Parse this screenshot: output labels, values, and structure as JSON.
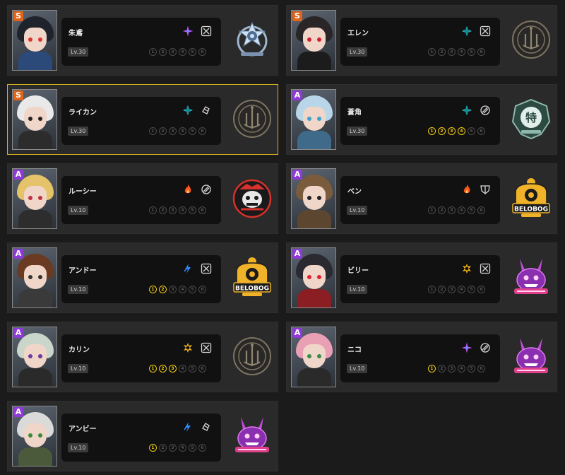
{
  "cinema_numbers": [
    "1",
    "2",
    "3",
    "4",
    "5",
    "6"
  ],
  "colors": {
    "attr_ice": "#1fc9d8",
    "attr_fire": "#ff5a1e",
    "attr_electric": "#2f8cff",
    "attr_physical": "#f3b41a",
    "attr_ether": "#d44bff",
    "cinema_on": "#f4cc12",
    "selected_border": "#d7b11f"
  },
  "agents": [
    {
      "name": "朱鳶",
      "level": "Lv.30",
      "rank": "S",
      "attribute": "ether",
      "specialty": "attack",
      "cinema": 0,
      "faction": "public-security",
      "selected": false,
      "hair": "#1f232c",
      "eye": "#d33",
      "body": "#2b4a7a"
    },
    {
      "name": "エレン",
      "level": "Lv.30",
      "rank": "S",
      "attribute": "ice",
      "specialty": "attack",
      "cinema": 0,
      "faction": "victoria-housekeeping",
      "selected": false,
      "hair": "#2a2628",
      "eye": "#d02030",
      "body": "#1c1c1c"
    },
    {
      "name": "ライカン",
      "level": "Lv.30",
      "rank": "S",
      "attribute": "ice",
      "specialty": "stun",
      "cinema": 0,
      "faction": "victoria-housekeeping",
      "selected": true,
      "hair": "#e9e9e9",
      "eye": "#222",
      "body": "#2c2c2c"
    },
    {
      "name": "蒼角",
      "level": "Lv.30",
      "rank": "A",
      "attribute": "ice",
      "specialty": "support",
      "cinema": 4,
      "faction": "section-6",
      "selected": false,
      "hair": "#b8d6e8",
      "eye": "#3aa0d0",
      "body": "#3f6a8a"
    },
    {
      "name": "ルーシー",
      "level": "Lv.10",
      "rank": "A",
      "attribute": "fire",
      "specialty": "support",
      "cinema": 0,
      "faction": "sons-of-calydon",
      "selected": false,
      "hair": "#e4c36a",
      "eye": "#c03040",
      "body": "#2d2d2d"
    },
    {
      "name": "ベン",
      "level": "Lv.10",
      "rank": "A",
      "attribute": "fire",
      "specialty": "defense",
      "cinema": 0,
      "faction": "belobog",
      "selected": false,
      "hair": "#7a5b3c",
      "eye": "#222",
      "body": "#5c4630"
    },
    {
      "name": "アンドー",
      "level": "Lv.10",
      "rank": "A",
      "attribute": "electric",
      "specialty": "attack",
      "cinema": 2,
      "faction": "belobog",
      "selected": false,
      "hair": "#6a3a22",
      "eye": "#333",
      "body": "#3a3a3a"
    },
    {
      "name": "ビリー",
      "level": "Lv.10",
      "rank": "A",
      "attribute": "physical",
      "specialty": "attack",
      "cinema": 0,
      "faction": "cunning-hares",
      "selected": false,
      "hair": "#2a2a30",
      "eye": "#e02030",
      "body": "#8a1e22"
    },
    {
      "name": "カリン",
      "level": "Lv.10",
      "rank": "A",
      "attribute": "physical",
      "specialty": "attack",
      "cinema": 3,
      "faction": "victoria-housekeeping",
      "selected": false,
      "hair": "#c9d6c9",
      "eye": "#6a3aa0",
      "body": "#2a2a2a"
    },
    {
      "name": "ニコ",
      "level": "Lv.10",
      "rank": "A",
      "attribute": "ether",
      "specialty": "support",
      "cinema": 1,
      "faction": "cunning-hares",
      "selected": false,
      "hair": "#e9a0b4",
      "eye": "#3a8a4a",
      "body": "#2a2a2a"
    },
    {
      "name": "アンビー",
      "level": "Lv.10",
      "rank": "A",
      "attribute": "electric",
      "specialty": "stun",
      "cinema": 1,
      "faction": "cunning-hares",
      "selected": false,
      "hair": "#dadada",
      "eye": "#3a8a3a",
      "body": "#4a5a3a"
    }
  ],
  "faction_logos": {
    "belobog": "BELOBOG",
    "section-6": "特"
  }
}
